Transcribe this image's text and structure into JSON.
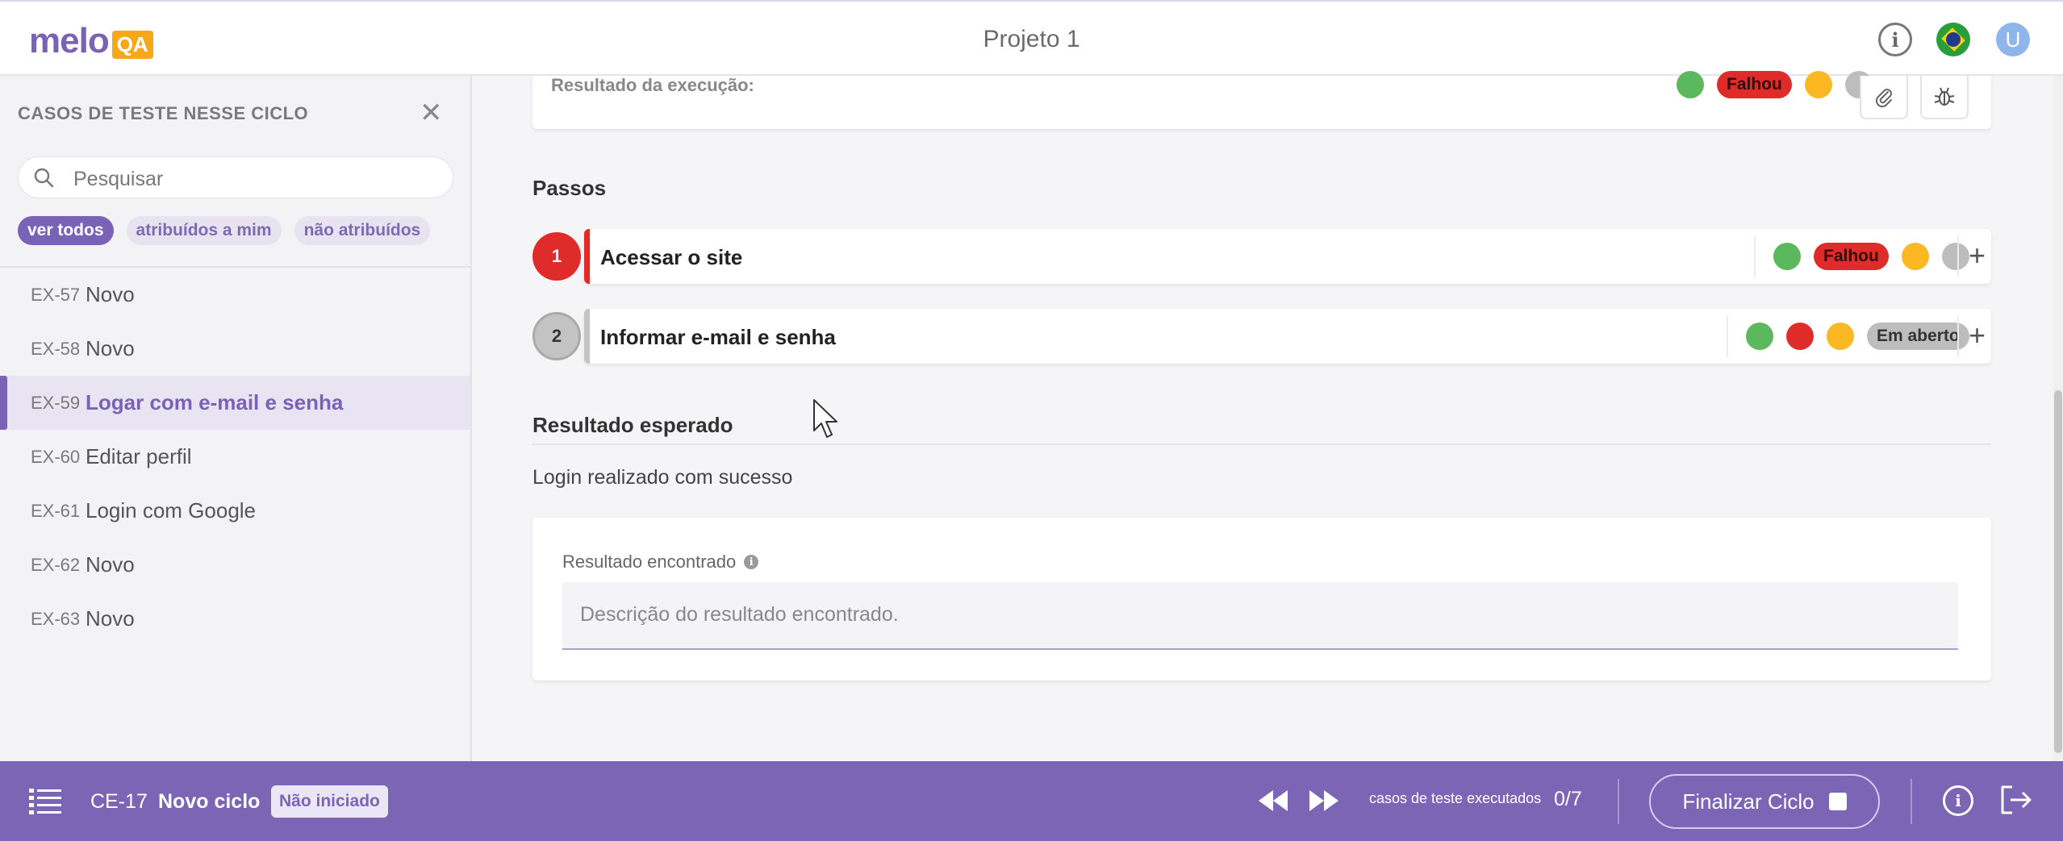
{
  "header": {
    "logo_text": "melo",
    "logo_badge": "QA",
    "project_title": "Projeto 1",
    "avatar_letter": "U",
    "info_glyph": "i"
  },
  "sidebar": {
    "title": "CASOS DE TESTE NESSE CICLO",
    "close_glyph": "✕",
    "search_placeholder": "Pesquisar",
    "filters": [
      {
        "label": "ver todos",
        "active": true
      },
      {
        "label": "atribuídos a mim",
        "active": false
      },
      {
        "label": "não atribuídos",
        "active": false
      }
    ],
    "items": [
      {
        "code": "EX-57",
        "name": "Novo"
      },
      {
        "code": "EX-58",
        "name": "Novo"
      },
      {
        "code": "EX-59",
        "name": "Logar com e-mail e senha",
        "selected": true
      },
      {
        "code": "EX-60",
        "name": "Editar perfil"
      },
      {
        "code": "EX-61",
        "name": "Login com Google"
      },
      {
        "code": "EX-62",
        "name": "Novo"
      },
      {
        "code": "EX-63",
        "name": "Novo"
      }
    ]
  },
  "execution": {
    "label": "Resultado da execução:",
    "status_label": "Falhou",
    "attach_icon": "paperclip-icon",
    "bug_icon": "bug-icon"
  },
  "steps": {
    "title": "Passos",
    "items": [
      {
        "number": "1",
        "label": "Acessar o site",
        "status": "Falhou",
        "plus": "+"
      },
      {
        "number": "2",
        "label": "Informar e-mail e senha",
        "status": "Em aberto",
        "plus": "+"
      }
    ]
  },
  "expected": {
    "title": "Resultado esperado",
    "text": "Login realizado com sucesso"
  },
  "found": {
    "label": "Resultado encontrado",
    "info_glyph": "i",
    "placeholder": "Descrição do resultado encontrado."
  },
  "footer": {
    "cycle_code": "CE-17",
    "cycle_name": "Novo ciclo",
    "cycle_status": "Não iniciado",
    "executed_label": "casos de teste executados",
    "executed_count": "0/7",
    "finish_label": "Finalizar Ciclo",
    "info_glyph": "i"
  },
  "colors": {
    "brand": "#7a63b6",
    "fail": "#e02b2b",
    "pass": "#5cb85c",
    "blocked": "#fbb823",
    "open": "#bdbdbd",
    "footer_bg": "#7c65b5"
  }
}
